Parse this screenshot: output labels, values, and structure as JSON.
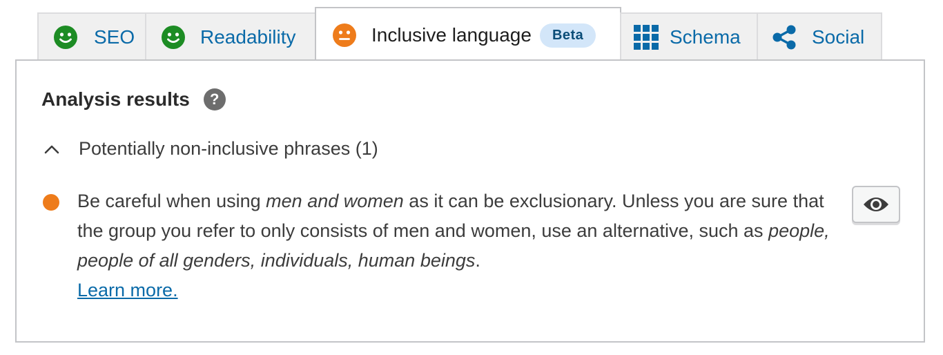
{
  "tabs": [
    {
      "label": "SEO",
      "icon": "smiley-happy-icon",
      "status_color": "#1d8c24"
    },
    {
      "label": "Readability",
      "icon": "smiley-happy-icon",
      "status_color": "#1d8c24"
    },
    {
      "label": "Inclusive language",
      "icon": "smiley-neutral-icon",
      "status_color": "#ee7c1b",
      "badge": "Beta",
      "active": true
    },
    {
      "label": "Schema",
      "icon": "grid-icon"
    },
    {
      "label": "Social",
      "icon": "share-icon"
    }
  ],
  "panel": {
    "heading": "Analysis results",
    "help_icon": "?",
    "section": {
      "label": "Potentially non-inclusive phrases (1)",
      "expanded": true
    },
    "result": {
      "status_color": "#ee7c1b",
      "part1": "Be careful when using ",
      "em1": "men and women",
      "part2": " as it can be exclusionary. Unless you are sure that the group you refer to only consists of men and women, use an alternative, such as ",
      "em2": "people, people of all genders, individuals, human beings",
      "part3": ".",
      "link": "Learn more.",
      "action_icon": "eye-icon"
    }
  },
  "colors": {
    "accent": "#0a6aa8",
    "good": "#1d8c24",
    "warning": "#ee7c1b"
  }
}
